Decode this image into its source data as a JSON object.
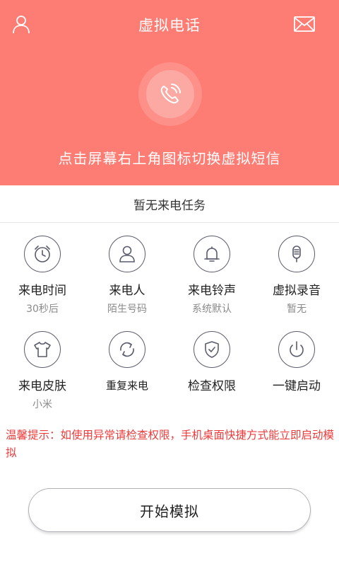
{
  "header": {
    "title": "虚拟电话",
    "subtitle": "点击屏幕右上角图标切换虚拟短信",
    "left_icon": "user-icon",
    "right_icon": "mail-icon",
    "background": "#fd7c74"
  },
  "status": "暂无来电任务",
  "grid": [
    {
      "icon": "alarm-clock-icon",
      "label": "来电时间",
      "sub": "30秒后"
    },
    {
      "icon": "person-icon",
      "label": "来电人",
      "sub": "陌生号码"
    },
    {
      "icon": "bell-icon",
      "label": "来电铃声",
      "sub": "系统默认"
    },
    {
      "icon": "microphone-icon",
      "label": "虚拟录音",
      "sub": "暂无"
    },
    {
      "icon": "shirt-icon",
      "label": "来电皮肤",
      "sub": "小米"
    },
    {
      "icon": "repeat-icon",
      "label": "重复来电",
      "sub": ""
    },
    {
      "icon": "shield-check-icon",
      "label": "检查权限",
      "sub": ""
    },
    {
      "icon": "power-icon",
      "label": "一键启动",
      "sub": ""
    }
  ],
  "tip": "温馨提示：如使用异常请检查权限，手机桌面快捷方式能立即启动模拟",
  "start_button": "开始模拟",
  "colors": {
    "accent": "#fd7c74",
    "tip": "#ee3b3b",
    "icon_stroke": "#5a5b6e"
  }
}
